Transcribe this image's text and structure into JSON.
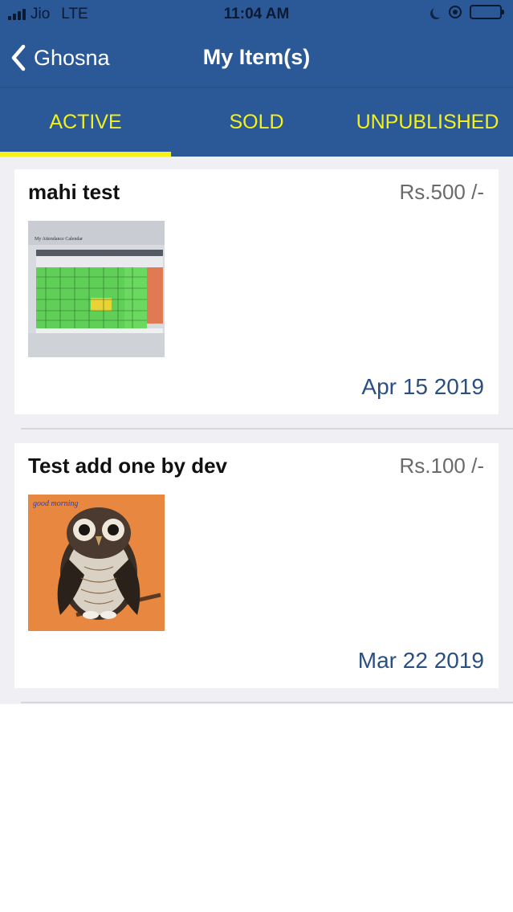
{
  "status_bar": {
    "carrier": "Jio",
    "network": "LTE",
    "time": "11:04 AM",
    "icons": [
      "signal-icon",
      "do-not-disturb-icon",
      "orientation-lock-icon",
      "battery-icon"
    ]
  },
  "nav": {
    "back_label": "Ghosna",
    "title": "My Item(s)"
  },
  "tabs": [
    {
      "label": "ACTIVE",
      "active": true
    },
    {
      "label": "SOLD",
      "active": false
    },
    {
      "label": "UNPUBLISHED",
      "active": false
    }
  ],
  "items": [
    {
      "title": "mahi test",
      "price": "Rs.500 /-",
      "date": "Apr 15 2019",
      "thumbnail": "spreadsheet-photo",
      "thumbnail_caption": "My Attendance Calendar"
    },
    {
      "title": "Test add one by dev",
      "price": "Rs.100 /-",
      "date": "Mar 22 2019",
      "thumbnail": "owl-artwork",
      "thumbnail_caption": "good morning"
    }
  ],
  "colors": {
    "header_bg": "#2b5897",
    "tab_text": "#f4f11a",
    "list_bg": "#efeff4",
    "date_text": "#2b4f80",
    "price_text": "#6a6a6a"
  }
}
